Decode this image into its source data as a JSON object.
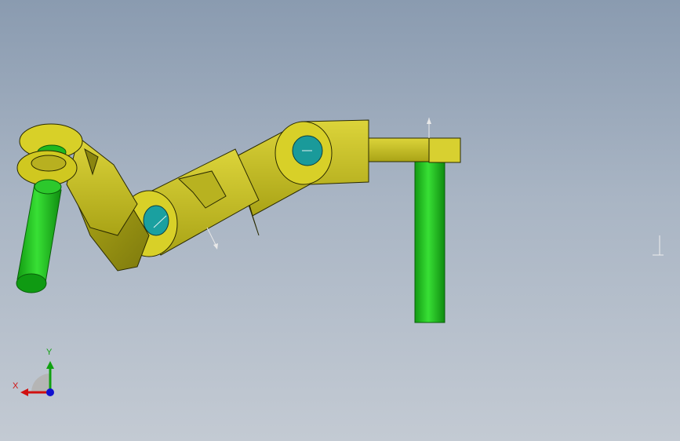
{
  "viewport": {
    "background_top": "#8a9bb0",
    "background_bottom": "#c3cad3"
  },
  "model": {
    "part_color": "#c9c41a",
    "part_shadow": "#8f8a10",
    "pin_color": "#1fc21f",
    "pin_dark": "#0d8a12",
    "hole_color": "#1a8f8f"
  },
  "triad": {
    "x_label": "X",
    "y_label": "Y",
    "x_color": "#d01010",
    "y_color": "#10a010",
    "z_color": "#1010d0"
  },
  "icons": [
    "triad-icon",
    "reference-triad-icon"
  ]
}
